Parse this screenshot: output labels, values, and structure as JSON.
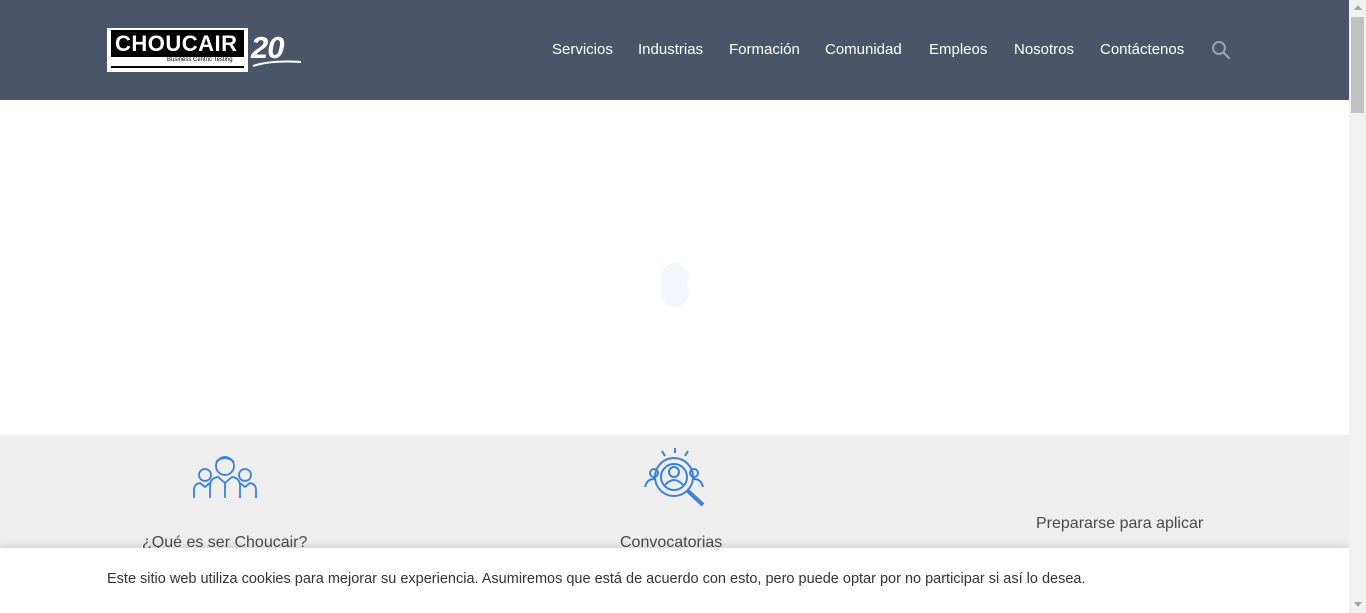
{
  "header": {
    "logo": {
      "word": "CHOUCAIR",
      "reg": "®",
      "tagline": "Business Centric Testing",
      "anniversary": "20"
    },
    "nav": [
      {
        "label": "Servicios"
      },
      {
        "label": "Industrias"
      },
      {
        "label": "Formación"
      },
      {
        "label": "Comunidad"
      },
      {
        "label": "Empleos"
      },
      {
        "label": "Nosotros"
      },
      {
        "label": "Contáctenos"
      }
    ],
    "search_icon": "search-icon"
  },
  "features": [
    {
      "title": "¿Qué es ser Choucair?",
      "icon": "team-icon"
    },
    {
      "title": "Convocatorias",
      "icon": "recruitment-search-icon"
    },
    {
      "title": "Prepararse para aplicar",
      "icon": ""
    }
  ],
  "cookie": {
    "text": "Este sitio web utiliza cookies para mejorar su experiencia. Asumiremos que está de acuerdo con esto, pero puede optar por no participar si así lo desea."
  },
  "colors": {
    "header_bg": "#4a5568",
    "icon_blue": "#3b82d6",
    "band_bg": "#eeeeee"
  }
}
